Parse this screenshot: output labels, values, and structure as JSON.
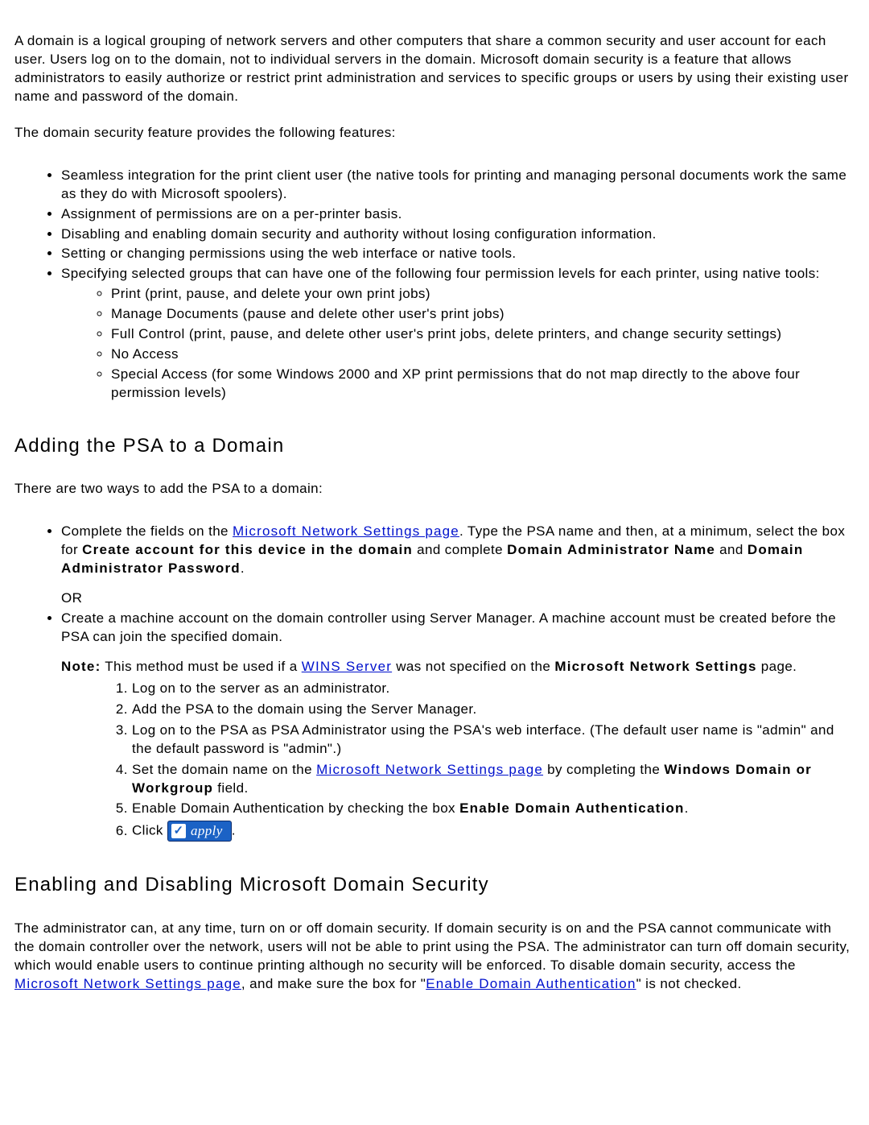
{
  "intro": {
    "p1": "A domain is a logical grouping of network servers and other computers that share a common security and user account for each user. Users log on to the domain, not to individual servers in the domain. Microsoft domain security is a feature that allows administrators to easily authorize or restrict print administration and services to specific groups or users by using their existing user name and password of the domain.",
    "p2": "The domain security feature provides the following features:"
  },
  "features": {
    "items": [
      "Seamless integration for the print client user (the native tools for printing and managing personal documents work the same as they do with Microsoft spoolers).",
      "Assignment of permissions are on a per-printer basis.",
      "Disabling and enabling domain security and authority without losing configuration information.",
      "Setting or changing permissions using the web interface or native tools.",
      "Specifying selected groups that can have one of the following four permission levels for each printer, using native tools:"
    ],
    "sub": [
      "Print (print, pause, and delete your own print jobs)",
      "Manage Documents (pause and delete other user's print jobs)",
      "Full Control (print, pause, and delete other user's print jobs, delete printers, and change security settings)",
      "No Access",
      "Special Access (for some Windows 2000 and XP print permissions that do not map directly to the above four permission levels)"
    ]
  },
  "adding": {
    "heading": "Adding the PSA to a Domain",
    "intro": "There are two ways to add the PSA to a domain:",
    "opt1_pre": "Complete the fields on the ",
    "opt1_link": "Microsoft Network Settings page",
    "opt1_post_a": ". Type the PSA name and then, at a minimum, select the box for ",
    "opt1_bold_a": "Create account for this device in the domain",
    "opt1_mid": " and complete ",
    "opt1_bold_b": "Domain Administrator Name",
    "opt1_and": " and ",
    "opt1_bold_c": "Domain Administrator Password",
    "opt1_end": ".",
    "or": "OR",
    "opt2_p1": "Create a machine account on the domain controller using Server Manager. A machine account must be created before the PSA can join the specified domain.",
    "opt2_note_label": "Note:",
    "opt2_note_pre": " This method must be used if a ",
    "opt2_note_link": "WINS Server",
    "opt2_note_post_a": " was not specified on the ",
    "opt2_note_bold": "Microsoft Network Settings",
    "opt2_note_post_b": " page.",
    "steps": {
      "s1": "Log on to the server as an administrator.",
      "s2": "Add the PSA to the domain using the Server Manager.",
      "s3": "Log on to the PSA as PSA Administrator using the PSA's web interface. (The default user name is \"admin\" and the default password is \"admin\".)",
      "s4_pre": "Set the domain name on the ",
      "s4_link": "Microsoft Network Settings page",
      "s4_post_a": " by completing the ",
      "s4_bold": "Windows Domain or Workgroup",
      "s4_post_b": " field.",
      "s5_pre": "Enable Domain Authentication by checking the box ",
      "s5_bold": "Enable Domain Authentication",
      "s5_post": ".",
      "s6_pre": "Click ",
      "s6_btn": "apply",
      "s6_post": "."
    }
  },
  "enabling": {
    "heading": "Enabling and Disabling Microsoft Domain Security",
    "p_pre": "The administrator can, at any time, turn on or off domain security. If domain security is on and the PSA cannot communicate with the domain controller over the network, users will not be able to print using the PSA. The administrator can turn off domain security, which would enable users to continue printing although no security will be enforced. To disable domain security, access the ",
    "p_link1": "Microsoft Network Settings page",
    "p_mid": ", and make sure the box for \"",
    "p_link2": "Enable Domain Authentication",
    "p_post": "\" is not checked."
  }
}
